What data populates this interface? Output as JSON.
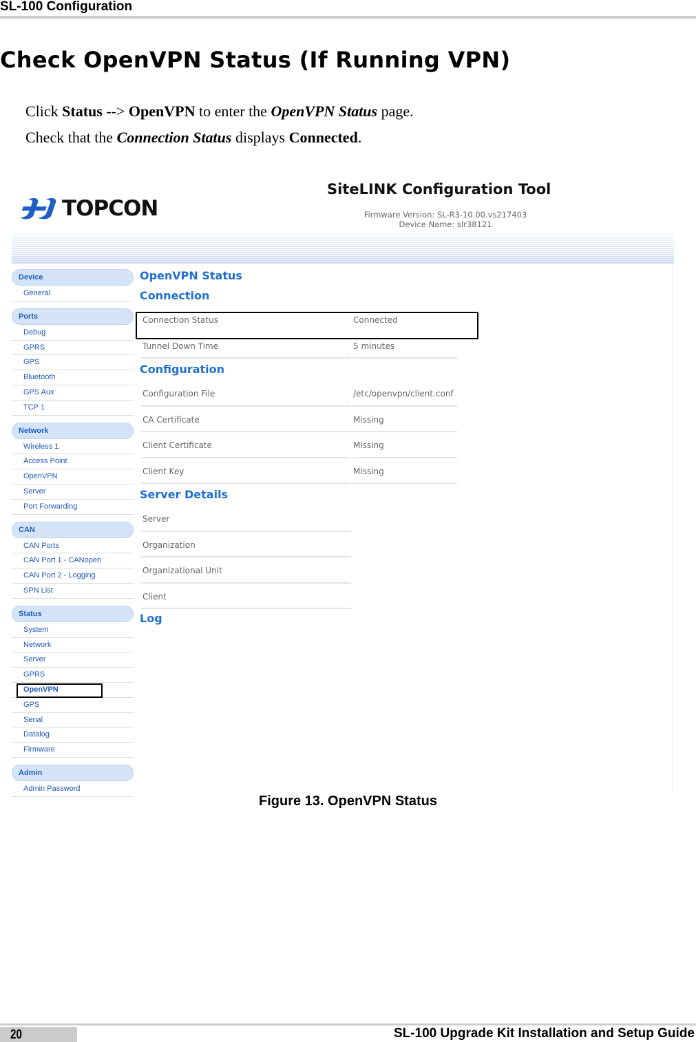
{
  "doc": {
    "running_header": "SL-100 Configuration",
    "section_title": "Check OpenVPN Status (If Running VPN)",
    "para1": {
      "t1": "Click ",
      "b1": "Status",
      "t2": " --> ",
      "b2": "OpenVPN",
      "t3": " to enter the ",
      "bi1": "OpenVPN Status",
      "t4": " page."
    },
    "para2": {
      "t1": "Check that the ",
      "bi1": "Connection Status",
      "t2": " displays ",
      "b1": "Connected",
      "t3": "."
    },
    "figure_caption": "Figure 13. OpenVPN Status",
    "footer": {
      "page_number": "20",
      "title": "SL-100 Upgrade Kit Installation and Setup Guide"
    }
  },
  "app": {
    "logo_text": "TOPCON",
    "logo_icon": "topcon-logo-icon",
    "title": "SiteLINK Configuration Tool",
    "firmware_version": "Firmware Version: SL-R3-10.00.vs217403",
    "device_name": "Device Name: slr38121",
    "brand_color": "#1f6fd0",
    "sidebar": {
      "groups": [
        {
          "label": "Device",
          "items": [
            "General"
          ]
        },
        {
          "label": "Ports",
          "items": [
            "Debug",
            "GPRS",
            "GPS",
            "Bluetooth",
            "GPS Aux",
            "TCP 1"
          ]
        },
        {
          "label": "Network",
          "items": [
            "Wireless 1",
            "Access Point",
            "OpenVPN",
            "Server",
            "Port Forwarding"
          ]
        },
        {
          "label": "CAN",
          "items": [
            "CAN Ports",
            "CAN Port 1 - CANopen",
            "CAN Port 2 - Logging",
            "SPN List"
          ]
        },
        {
          "label": "Status",
          "items": [
            "System",
            "Network",
            "Server",
            "GPRS",
            "OpenVPN",
            "GPS",
            "Serial",
            "Datalog",
            "Firmware"
          ]
        },
        {
          "label": "Admin",
          "items": [
            "Admin Password"
          ]
        }
      ],
      "active_item": "Status > OpenVPN"
    },
    "page": {
      "title": "OpenVPN Status",
      "connection": {
        "heading": "Connection",
        "rows": [
          {
            "label": "Connection Status",
            "value": "Connected"
          },
          {
            "label": "Tunnel Down Time",
            "value": "5 minutes"
          }
        ]
      },
      "configuration": {
        "heading": "Configuration",
        "rows": [
          {
            "label": "Configuration File",
            "value": "/etc/openvpn/client.conf"
          },
          {
            "label": "CA Certificate",
            "value": "Missing"
          },
          {
            "label": "Client Certificate",
            "value": "Missing"
          },
          {
            "label": "Client Key",
            "value": "Missing"
          }
        ]
      },
      "server_details": {
        "heading": "Server Details",
        "rows": [
          {
            "label": "Server",
            "value": ""
          },
          {
            "label": "Organization",
            "value": ""
          },
          {
            "label": "Organizational Unit",
            "value": ""
          },
          {
            "label": "Client",
            "value": ""
          }
        ]
      },
      "log": {
        "heading": "Log"
      }
    }
  }
}
